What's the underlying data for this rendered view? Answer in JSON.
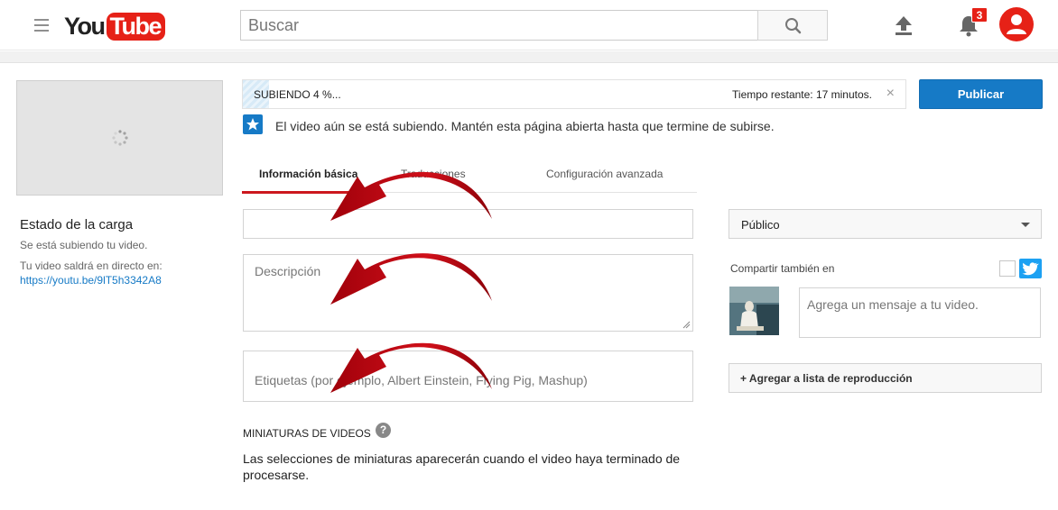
{
  "header": {
    "logo_you": "You",
    "logo_tube": "Tube",
    "search_placeholder": "Buscar",
    "notifications_count": "3",
    "brand_color": "#e62117"
  },
  "sidebar": {
    "status_title": "Estado de la carga",
    "status_sub": "Se está subiendo tu video.",
    "live_label": "Tu video saldrá en directo en:",
    "video_url": "https://youtu.be/9lT5h3342A8"
  },
  "upload": {
    "progress_label": "SUBIENDO 4 %...",
    "progress_fraction": 0.04,
    "remaining": "Tiempo restante: 17 minutos.",
    "close_glyph": "×",
    "publish_label": "Publicar",
    "notice": "El video aún se está subiendo. Mantén esta página abierta hasta que termine de subirse."
  },
  "tabs": [
    {
      "label": "Información básica",
      "active": true
    },
    {
      "label": "Traducciones",
      "active": false
    },
    {
      "label": "Configuración avanzada",
      "active": false
    }
  ],
  "form": {
    "title_value": "",
    "description_placeholder": "Descripción",
    "tags_placeholder": "Etiquetas (por ejemplo, Albert Einstein, Flying Pig, Mashup)",
    "privacy_value": "Público",
    "share_label": "Compartir también en",
    "share_message_placeholder": "Agrega un mensaje a tu video.",
    "playlist_label": "+ Agregar a lista de reproducción"
  },
  "thumbnails": {
    "heading": "MINIATURAS DE VIDEOS",
    "help_glyph": "?",
    "message": "Las selecciones de miniaturas aparecerán cuando el video haya terminado de procesarse."
  },
  "colors": {
    "accent_blue": "#167ac6",
    "annotation_red": "#c8000a",
    "twitter_blue": "#1da1f2"
  }
}
